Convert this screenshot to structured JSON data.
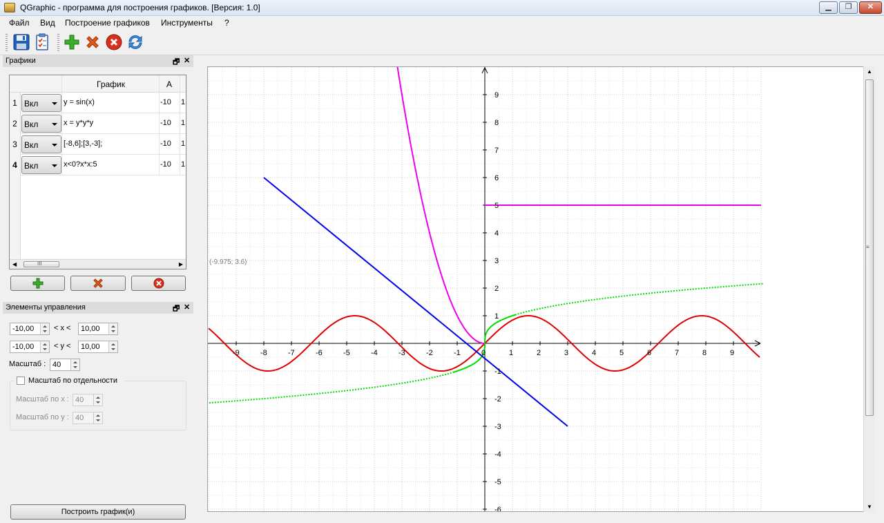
{
  "window": {
    "title": "QGraphic - программа для построения графиков. [Версия: 1.0]"
  },
  "menu": [
    "Файл",
    "Вид",
    "Построение графиков",
    "Инструменты",
    "?"
  ],
  "toolbar": {
    "icons": [
      "save-icon",
      "checklist-icon",
      "add-icon",
      "delete-icon",
      "remove-all-icon",
      "refresh-icon"
    ]
  },
  "graphs_panel": {
    "title": "Графики",
    "columns": [
      "График",
      "A"
    ],
    "rows": [
      {
        "num": "1",
        "state": "Вкл",
        "expr": "y = sin(x)",
        "a": "-10",
        "b": "1"
      },
      {
        "num": "2",
        "state": "Вкл",
        "expr": "x = y*y*y",
        "a": "-10",
        "b": "1"
      },
      {
        "num": "3",
        "state": "Вкл",
        "expr": "[-8,6];[3,-3];",
        "a": "-10",
        "b": "1"
      },
      {
        "num": "4",
        "state": "Вкл",
        "expr": "x<0?x*x:5",
        "a": "-10",
        "b": "1"
      }
    ],
    "scroll_grip": "III"
  },
  "controls_panel": {
    "title": "Элементы управления",
    "x_min": "-10,00",
    "x_label": "< x <",
    "x_max": "10,00",
    "y_min": "-10,00",
    "y_label": "< y <",
    "y_max": "10,00",
    "scale_label": "Масштаб :",
    "scale": "40",
    "separate_label": "Масштаб по отдельности",
    "scale_x_label": "Масштаб по x :",
    "scale_x": "40",
    "scale_y_label": "Масштаб по y :",
    "scale_y": "40",
    "build_button": "Построить график(и)"
  },
  "plot": {
    "cursor_readout": "(-9.975; 3.6)",
    "x_ticks": [
      "-9",
      "-8",
      "-7",
      "-6",
      "-5",
      "-4",
      "-3",
      "-2",
      "-1",
      "0",
      "1",
      "2",
      "3",
      "4",
      "5",
      "6",
      "7",
      "8",
      "9"
    ],
    "y_ticks": [
      "9",
      "8",
      "7",
      "6",
      "5",
      "4",
      "3",
      "2",
      "1",
      "-1",
      "-2",
      "-3",
      "-4",
      "-5",
      "-6"
    ],
    "colors": {
      "sin": "#e00000",
      "cube": "#00dd00",
      "segment": "#0000ee",
      "piecewise": "#ee00ee"
    }
  },
  "chart_data": {
    "type": "line",
    "xlim": [
      -10,
      10
    ],
    "ylim": [
      -6,
      10
    ],
    "grid": true,
    "series": [
      {
        "name": "y = sin(x)",
        "color": "#e00000",
        "kind": "function",
        "x_range": [
          -10,
          10
        ]
      },
      {
        "name": "x = y*y*y",
        "color": "#00dd00",
        "kind": "inverse_function",
        "y_range": [
          -2.2,
          2.2
        ]
      },
      {
        "name": "[-8,6];[3,-3];",
        "color": "#0000ee",
        "kind": "segment",
        "points": [
          [
            -8,
            6
          ],
          [
            3,
            -3
          ]
        ]
      },
      {
        "name": "x<0?x*x:5",
        "color": "#ee00ee",
        "kind": "piecewise",
        "x_range": [
          -3.2,
          10
        ]
      }
    ]
  }
}
